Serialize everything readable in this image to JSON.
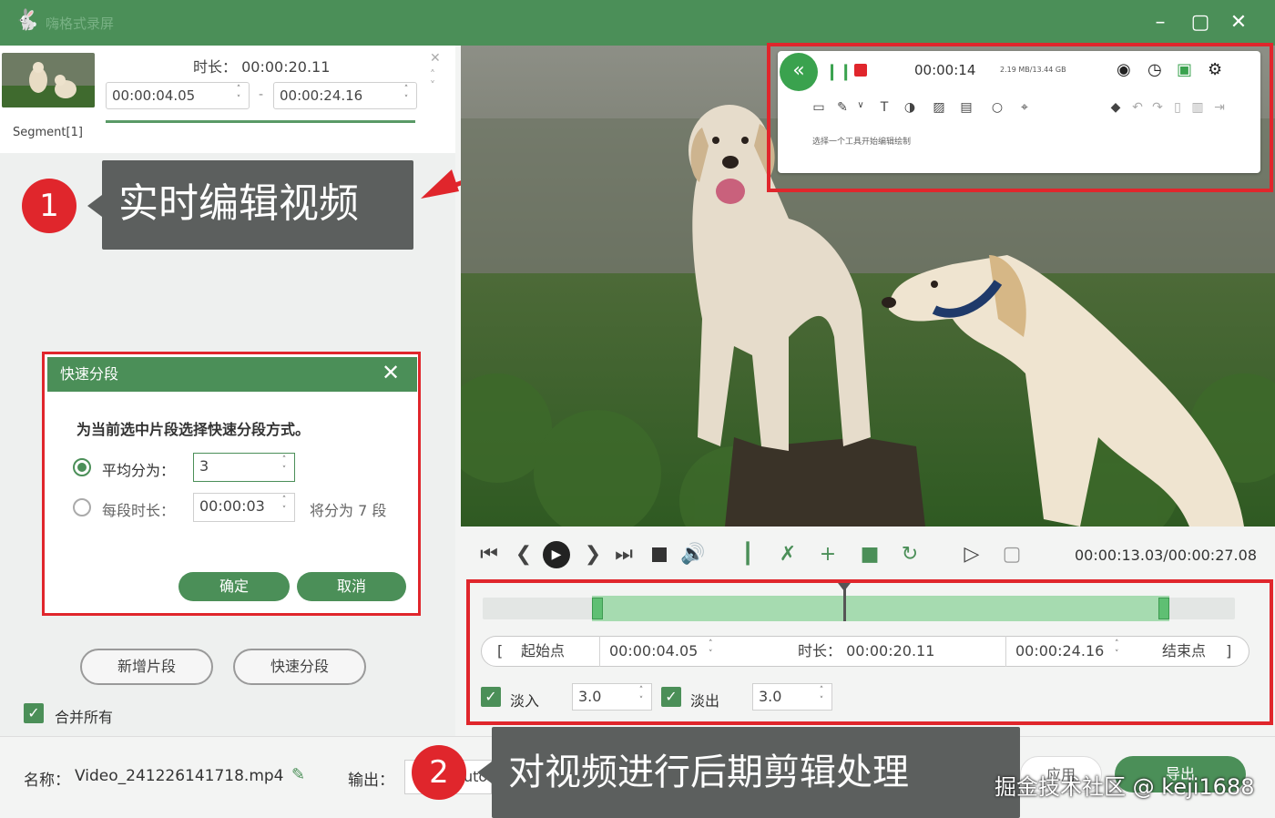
{
  "app": {
    "title": "嗨格式录屏"
  },
  "segment": {
    "label": "Segment[1]",
    "duration_label": "时长：",
    "duration": "00:00:20.11",
    "start": "00:00:04.05",
    "end": "00:00:24.16",
    "separator": "-"
  },
  "callouts": {
    "one": {
      "number": "1",
      "text": "实时编辑视频"
    },
    "two": {
      "number": "2",
      "text": "对视频进行后期剪辑处理"
    }
  },
  "dialog": {
    "title": "快速分段",
    "prompt": "为当前选中片段选择快速分段方式。",
    "even_label": "平均分为：",
    "even_value": "3",
    "per_label": "每段时长：",
    "per_value": "00:00:03",
    "per_result": "将分为 7 段",
    "ok": "确定",
    "cancel": "取消"
  },
  "left_buttons": {
    "add_segment": "新增片段",
    "quick_split": "快速分段",
    "merge_all": "合并所有"
  },
  "bottom": {
    "name_label": "名称：",
    "name_value": "Video_241226141718.mp4",
    "output_label": "输出：",
    "output_value": "uto",
    "apply_label": "应用",
    "export_label": "导出"
  },
  "recorder": {
    "time": "00:00:14",
    "size": "2.19 MB/13.44 GB",
    "hint": "选择一个工具开始编辑绘制"
  },
  "player": {
    "time_display": "00:00:13.03/00:00:27.08"
  },
  "range": {
    "start_bracket": "[",
    "start_label": "起始点",
    "start_value": "00:00:04.05",
    "duration_label": "时长：",
    "duration_value": "00:00:20.11",
    "end_value": "00:00:24.16",
    "end_label": "结束点",
    "end_bracket": "]"
  },
  "fade": {
    "in_label": "淡入",
    "in_value": "3.0",
    "out_label": "淡出",
    "out_value": "3.0"
  },
  "watermark": "掘金技术社区 @ keji1688",
  "colors": {
    "brand_green": "#4b8f58",
    "highlight_red": "#e0262c",
    "callout_gray": "#5c5f5e",
    "timeline_selection": "#a6dbb0"
  },
  "icons": [
    "app-logo-icon",
    "minimize-icon",
    "maximize-icon",
    "close-icon",
    "chevron-up-icon",
    "chevron-down-icon",
    "skip-start-icon",
    "prev-frame-icon",
    "play-icon",
    "next-frame-icon",
    "skip-end-icon",
    "stop-icon",
    "volume-icon",
    "split-icon",
    "delete-icon",
    "add-icon",
    "copy-icon",
    "rotate-icon",
    "play-selection-icon",
    "fit-icon",
    "pencil-icon",
    "camera-icon",
    "timer-icon",
    "toolbox-icon",
    "settings-icon"
  ]
}
